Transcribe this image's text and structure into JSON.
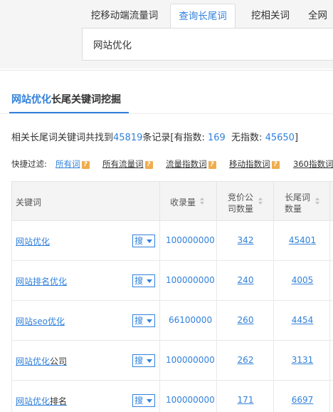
{
  "tabs": [
    {
      "label": "挖移动端流量词"
    },
    {
      "label": "查询长尾词"
    },
    {
      "label": "挖相关词"
    },
    {
      "label": "全网"
    }
  ],
  "search": {
    "value": "网站优化"
  },
  "heading": {
    "highlight": "网站优化",
    "rest": "长尾关键词挖掘"
  },
  "summary": {
    "prefix": "相关长尾词关键词共找到",
    "total": "45819",
    "mid1": "条记录[有指数: ",
    "with_index": "169",
    "mid2": "  无指数: ",
    "without_index": "45650",
    "suffix": "]"
  },
  "filters": {
    "label": "快捷过滤:",
    "items": [
      {
        "label": "所有词"
      },
      {
        "label": "所有流量词"
      },
      {
        "label": "流量指数词"
      },
      {
        "label": "移动指数词"
      },
      {
        "label": "360指数词"
      }
    ],
    "help_icon": "?"
  },
  "table": {
    "headers": {
      "keyword": "关键词",
      "volume": "收录量",
      "bid_line1": "竞价公",
      "bid_line2": "司数量",
      "long_line1": "长尾词",
      "long_line2": "数量"
    },
    "search_label": "搜",
    "rows": [
      {
        "kw_main": "网站优化",
        "kw_plain": "",
        "volume": "100000000",
        "bid": "342",
        "long": "45401"
      },
      {
        "kw_main": "网站排名优化",
        "kw_plain": "",
        "volume": "100000000",
        "bid": "240",
        "long": "4005"
      },
      {
        "kw_main": "网站seo优化",
        "kw_plain": "",
        "volume": "66100000",
        "bid": "260",
        "long": "4454"
      },
      {
        "kw_main": "网站优化",
        "kw_plain": "公司",
        "volume": "100000000",
        "bid": "262",
        "long": "3131"
      },
      {
        "kw_main": "网站优化",
        "kw_plain": "排名",
        "volume": "100000000",
        "bid": "171",
        "long": "6697"
      }
    ]
  },
  "colors": {
    "accent": "#3181db",
    "help": "#f0ad4e"
  }
}
